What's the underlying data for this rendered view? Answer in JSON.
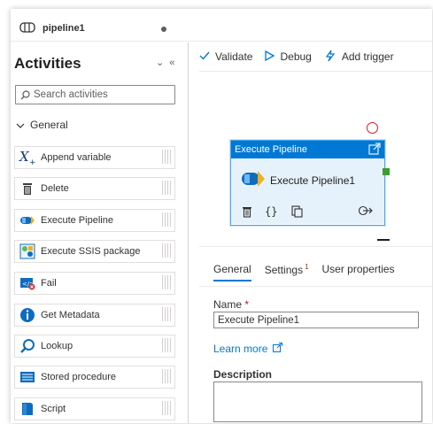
{
  "tab": {
    "title": "pipeline1"
  },
  "activities": {
    "heading": "Activities",
    "collapse_glyphs": "⌄«",
    "search_placeholder": "Search activities",
    "group": "General",
    "items": [
      {
        "label": "Append variable",
        "icon": "append-variable-icon"
      },
      {
        "label": "Delete",
        "icon": "delete-icon"
      },
      {
        "label": "Execute Pipeline",
        "icon": "execute-pipeline-icon"
      },
      {
        "label": "Execute SSIS package",
        "icon": "ssis-package-icon"
      },
      {
        "label": "Fail",
        "icon": "fail-icon"
      },
      {
        "label": "Get Metadata",
        "icon": "info-icon"
      },
      {
        "label": "Lookup",
        "icon": "lookup-icon"
      },
      {
        "label": "Stored procedure",
        "icon": "stored-procedure-icon"
      },
      {
        "label": "Script",
        "icon": "script-icon"
      }
    ]
  },
  "toolbar": {
    "validate": "Validate",
    "debug": "Debug",
    "add_trigger": "Add trigger"
  },
  "node": {
    "header": "Execute Pipeline",
    "name": "Execute Pipeline1"
  },
  "properties": {
    "tabs": [
      "General",
      "Settings",
      "User properties"
    ],
    "settings_badge": "1",
    "name_label": "Name",
    "name_required": "*",
    "name_value": "Execute Pipeline1",
    "learn_more": "Learn more",
    "description_label": "Description",
    "description_value": ""
  },
  "colors": {
    "accent": "#0078d4",
    "error": "#e81123",
    "success": "#3c9d34"
  }
}
